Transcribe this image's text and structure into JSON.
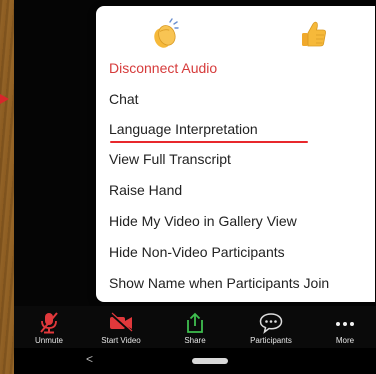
{
  "menu": {
    "reactions": [
      {
        "name": "clapping-hands-icon"
      },
      {
        "name": "thumbs-up-icon"
      }
    ],
    "items": [
      {
        "label": "Disconnect Audio"
      },
      {
        "label": "Chat"
      },
      {
        "label": "Language Interpretation"
      },
      {
        "label": "View Full Transcript"
      },
      {
        "label": "Raise Hand"
      },
      {
        "label": "Hide My Video in Gallery View"
      },
      {
        "label": "Hide Non-Video Participants"
      },
      {
        "label": "Show Name when Participants Join"
      }
    ]
  },
  "toolbar": {
    "items": [
      {
        "label": "Unmute",
        "icon": "muted-microphone-icon"
      },
      {
        "label": "Start Video",
        "icon": "video-off-icon"
      },
      {
        "label": "Share",
        "icon": "share-icon"
      },
      {
        "label": "Participants",
        "icon": "participants-chat-icon"
      },
      {
        "label": "More",
        "icon": "more-dots-icon"
      }
    ]
  },
  "navbar": {
    "back": "<"
  },
  "colors": {
    "danger": "#d63b3b",
    "highlight_underline": "#e8282c",
    "arrow": "#d7272b",
    "share_green": "#3fbf4f",
    "video_red": "#e0383b",
    "reaction_yellow": "#f6b93a"
  }
}
